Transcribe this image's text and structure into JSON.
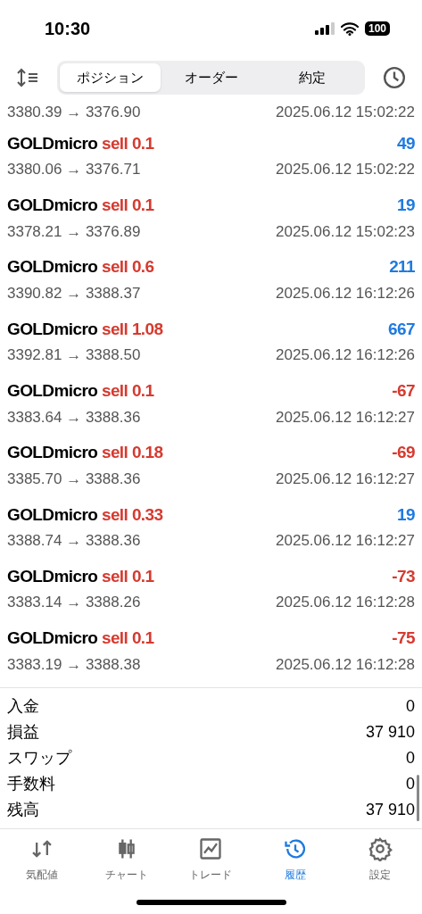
{
  "status_bar": {
    "time": "10:30",
    "battery": "100"
  },
  "tabs": [
    {
      "label": "ポジション",
      "selected": true
    },
    {
      "label": "オーダー",
      "selected": false
    },
    {
      "label": "約定",
      "selected": false
    }
  ],
  "partial_row": {
    "prices": "3380.39 → 3376.90",
    "time": "2025.06.12 15:02:22"
  },
  "trades": [
    {
      "symbol": "GOLDmicro",
      "side": "sell 0.1",
      "profit": "49",
      "kind": "gain",
      "prices": "3380.06 → 3376.71",
      "time": "2025.06.12 15:02:22"
    },
    {
      "symbol": "GOLDmicro",
      "side": "sell 0.1",
      "profit": "19",
      "kind": "gain",
      "prices": "3378.21 → 3376.89",
      "time": "2025.06.12 15:02:23"
    },
    {
      "symbol": "GOLDmicro",
      "side": "sell 0.6",
      "profit": "211",
      "kind": "gain",
      "prices": "3390.82 → 3388.37",
      "time": "2025.06.12 16:12:26"
    },
    {
      "symbol": "GOLDmicro",
      "side": "sell 1.08",
      "profit": "667",
      "kind": "gain",
      "prices": "3392.81 → 3388.50",
      "time": "2025.06.12 16:12:26"
    },
    {
      "symbol": "GOLDmicro",
      "side": "sell 0.1",
      "profit": "-67",
      "kind": "loss",
      "prices": "3383.64 → 3388.36",
      "time": "2025.06.12 16:12:27"
    },
    {
      "symbol": "GOLDmicro",
      "side": "sell 0.18",
      "profit": "-69",
      "kind": "loss",
      "prices": "3385.70 → 3388.36",
      "time": "2025.06.12 16:12:27"
    },
    {
      "symbol": "GOLDmicro",
      "side": "sell 0.33",
      "profit": "19",
      "kind": "gain",
      "prices": "3388.74 → 3388.36",
      "time": "2025.06.12 16:12:27"
    },
    {
      "symbol": "GOLDmicro",
      "side": "sell 0.1",
      "profit": "-73",
      "kind": "loss",
      "prices": "3383.14 → 3388.26",
      "time": "2025.06.12 16:12:28"
    },
    {
      "symbol": "GOLDmicro",
      "side": "sell 0.1",
      "profit": "-75",
      "kind": "loss",
      "prices": "3383.19 → 3388.38",
      "time": "2025.06.12 16:12:28"
    }
  ],
  "summary": [
    {
      "label": "入金",
      "value": "0"
    },
    {
      "label": "損益",
      "value": "37 910"
    },
    {
      "label": "スワップ",
      "value": "0"
    },
    {
      "label": "手数料",
      "value": "0"
    },
    {
      "label": "残高",
      "value": "37 910"
    }
  ],
  "bottom_nav": [
    {
      "label": "気配値",
      "selected": false
    },
    {
      "label": "チャート",
      "selected": false
    },
    {
      "label": "トレード",
      "selected": false
    },
    {
      "label": "履歴",
      "selected": true
    },
    {
      "label": "設定",
      "selected": false
    }
  ]
}
